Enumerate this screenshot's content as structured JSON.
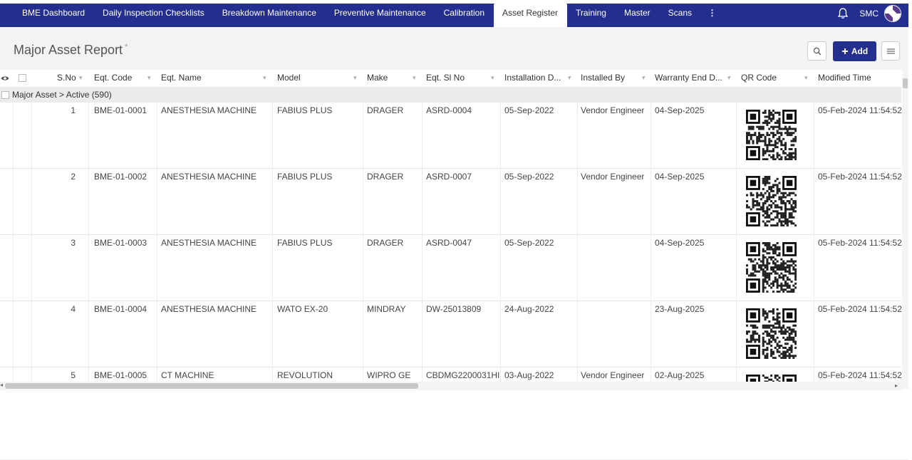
{
  "nav": {
    "tabs": [
      {
        "label": "BME Dashboard",
        "active": false
      },
      {
        "label": "Daily Inspection Checklists",
        "active": false
      },
      {
        "label": "Breakdown Maintenance",
        "active": false
      },
      {
        "label": "Preventive Maintenance",
        "active": false
      },
      {
        "label": "Calibration",
        "active": false
      },
      {
        "label": "Asset Register",
        "active": true
      },
      {
        "label": "Training",
        "active": false
      },
      {
        "label": "Master",
        "active": false
      },
      {
        "label": "Scans",
        "active": false
      }
    ],
    "more_icon": "⋮",
    "user": "SMC"
  },
  "toolbar": {
    "title": "Major Asset Report",
    "title_marker": "*",
    "add_label": "Add"
  },
  "grid": {
    "columns": [
      "S.No",
      "Eqt. Code",
      "Eqt. Name",
      "Model",
      "Make",
      "Eqt. Sl No",
      "Installation D...",
      "Installed By",
      "Warranty End D...",
      "QR Code",
      "Modified Time"
    ],
    "group": {
      "field": "Major Asset",
      "separator": ">",
      "value": "Active (590)"
    },
    "rows": [
      {
        "sno": "1",
        "code": "BME-01-0001",
        "name": "ANESTHESIA MACHINE",
        "model": "FABIUS PLUS",
        "make": "DRAGER",
        "slno": "ASRD-0004",
        "install": "05-Sep-2022",
        "installed_by": "Vendor Engineer",
        "warranty": "04-Sep-2025",
        "modified": "05-Feb-2024 11:54:52"
      },
      {
        "sno": "2",
        "code": "BME-01-0002",
        "name": "ANESTHESIA MACHINE",
        "model": "FABIUS PLUS",
        "make": "DRAGER",
        "slno": "ASRD-0007",
        "install": "05-Sep-2022",
        "installed_by": "Vendor Engineer",
        "warranty": "04-Sep-2025",
        "modified": "05-Feb-2024 11:54:52"
      },
      {
        "sno": "3",
        "code": "BME-01-0003",
        "name": "ANESTHESIA MACHINE",
        "model": "FABIUS PLUS",
        "make": "DRAGER",
        "slno": "ASRD-0047",
        "install": "05-Sep-2022",
        "installed_by": "",
        "warranty": "04-Sep-2025",
        "modified": "05-Feb-2024 11:54:52"
      },
      {
        "sno": "4",
        "code": "BME-01-0004",
        "name": "ANESTHESIA MACHINE",
        "model": "WATO EX-20",
        "make": "MINDRAY",
        "slno": "DW-25013809",
        "install": "24-Aug-2022",
        "installed_by": "",
        "warranty": "23-Aug-2025",
        "modified": "05-Feb-2024 11:54:52"
      },
      {
        "sno": "5",
        "code": "BME-01-0005",
        "name": "CT MACHINE",
        "model": "REVOLUTION",
        "make": "WIPRO GE",
        "slno": "CBDMG2200031HI",
        "install": "03-Aug-2022",
        "installed_by": "Vendor Engineer",
        "warranty": "02-Aug-2025",
        "modified": "05-Feb-2024 11:54:52"
      }
    ]
  },
  "colors": {
    "nav_bg": "#232e8f",
    "toolbar_bg": "#f3f3f3",
    "group_bg": "#ebebeb"
  }
}
